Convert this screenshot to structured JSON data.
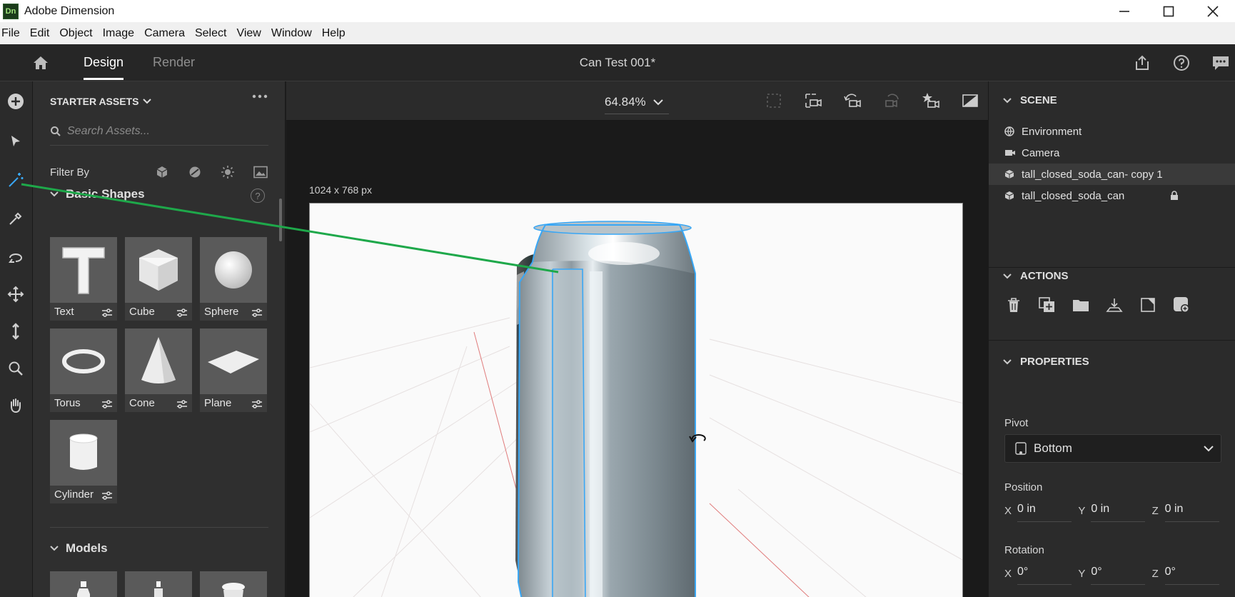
{
  "window": {
    "title": "Adobe Dimension",
    "logo_text": "Dn",
    "controls": [
      "minimize-icon",
      "maximize-icon",
      "close-icon"
    ]
  },
  "menu": [
    "File",
    "Edit",
    "Object",
    "Image",
    "Camera",
    "Select",
    "View",
    "Window",
    "Help"
  ],
  "appbar": {
    "tabs": [
      {
        "label": "Design",
        "active": true
      },
      {
        "label": "Render",
        "active": false
      }
    ],
    "document_title": "Can Test 001*",
    "right_icons": [
      "share-icon",
      "help-icon",
      "feedback-icon"
    ]
  },
  "toolbar": {
    "tools": [
      "add-icon",
      "select-tool-icon",
      "magic-wand-tool-icon",
      "sample-tool-icon",
      "orbit-tool-icon",
      "move-tool-icon",
      "dolly-tool-icon",
      "zoom-tool-icon",
      "pan-tool-icon"
    ],
    "active_tool": "magic-wand-tool-icon"
  },
  "assets": {
    "header": "STARTER ASSETS",
    "search_placeholder": "Search Assets...",
    "filter_label": "Filter By",
    "filter_icons": [
      "model-filter-icon",
      "material-filter-icon",
      "light-filter-icon",
      "image-filter-icon"
    ],
    "sections": {
      "basic_shapes": {
        "title": "Basic Shapes",
        "items": [
          {
            "label": "Text"
          },
          {
            "label": "Cube"
          },
          {
            "label": "Sphere"
          },
          {
            "label": "Torus"
          },
          {
            "label": "Cone"
          },
          {
            "label": "Plane"
          },
          {
            "label": "Cylinder"
          }
        ]
      },
      "models": {
        "title": "Models"
      }
    }
  },
  "canvas": {
    "zoom": "64.84%",
    "size_label": "1024 x 768 px"
  },
  "scene": {
    "title": "SCENE",
    "items": [
      {
        "label": "Environment",
        "icon": "environment-icon"
      },
      {
        "label": "Camera",
        "icon": "camera-icon"
      },
      {
        "label": "tall_closed_soda_can- copy 1",
        "icon": "model-icon",
        "selected": true
      },
      {
        "label": "tall_closed_soda_can",
        "icon": "model-icon",
        "locked": true
      }
    ]
  },
  "actions": {
    "title": "ACTIONS",
    "icons": [
      "delete-icon",
      "duplicate-icon",
      "group-icon",
      "place-on-ground-icon",
      "export-selected-icon",
      "create-material-icon"
    ]
  },
  "properties": {
    "title": "PROPERTIES",
    "pivot_label": "Pivot",
    "pivot_value": "Bottom",
    "position_label": "Position",
    "position": {
      "x_label": "X",
      "x": "0 in",
      "y_label": "Y",
      "y": "0 in",
      "z_label": "Z",
      "z": "0 in"
    },
    "rotation_label": "Rotation",
    "rotation": {
      "x_label": "X",
      "x": "0°",
      "y_label": "Y",
      "y": "0°",
      "z_label": "Z",
      "z": "0°"
    }
  },
  "colors": {
    "selection_outline": "#39a7f5",
    "annotation_arrow": "#1ea84a"
  }
}
